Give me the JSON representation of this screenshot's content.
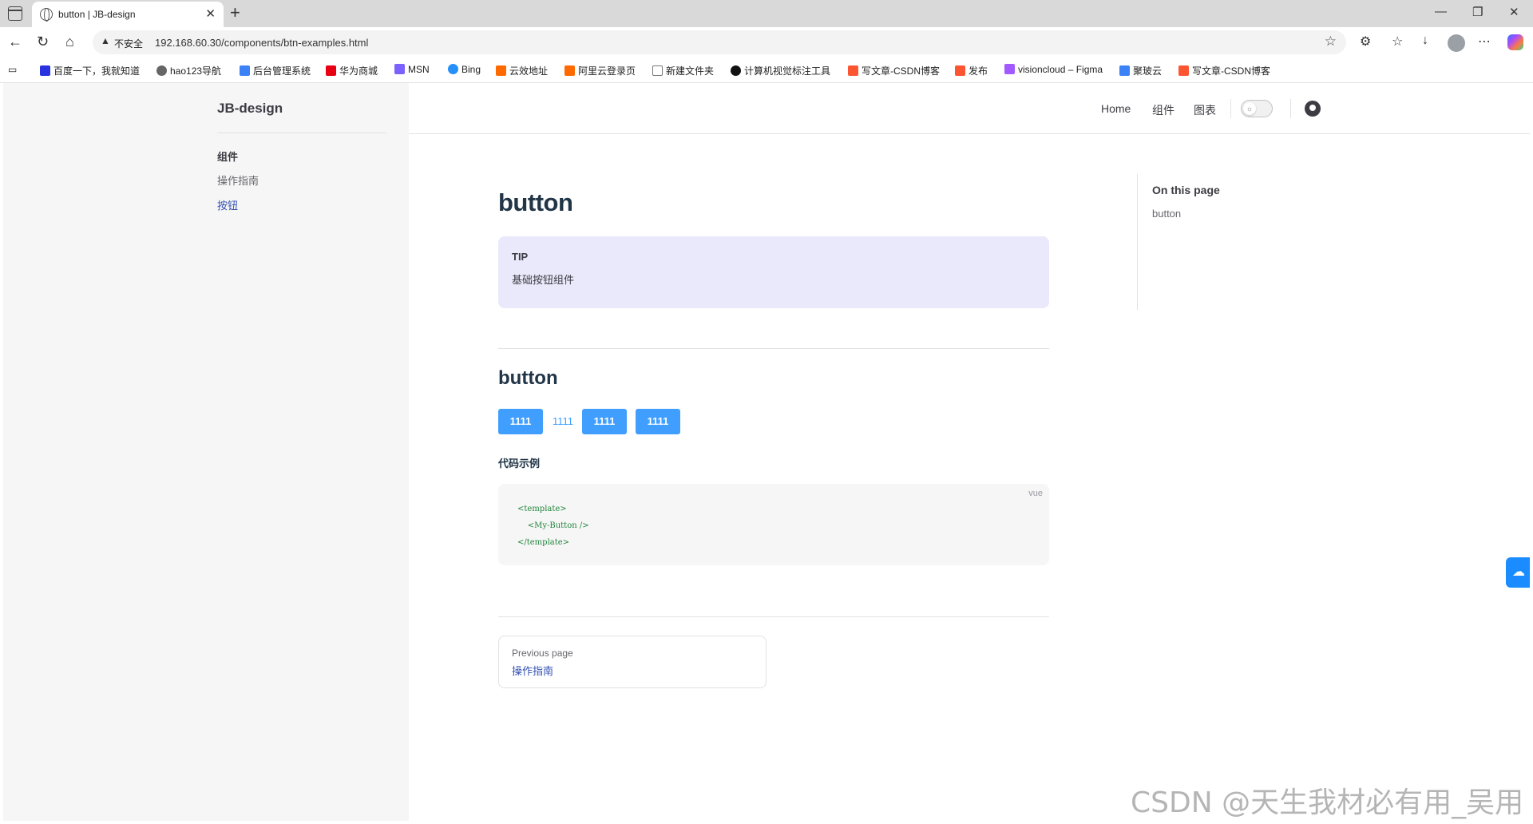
{
  "browser": {
    "tab_title": "button | JB-design",
    "tab_close": "✕",
    "new_tab": "+",
    "security_label": "不安全",
    "url": "192.168.60.30/components/btn-examples.html",
    "bookmarks": [
      {
        "label": "百度一下，我就知道",
        "color": "#2932e1"
      },
      {
        "label": "hao123导航",
        "color": "#666666"
      },
      {
        "label": "后台管理系统",
        "color": "#3b82f6"
      },
      {
        "label": "华为商城",
        "color": "#e60012"
      },
      {
        "label": "MSN",
        "color": "#7b61ff"
      },
      {
        "label": "Bing",
        "color": "#258ffa"
      },
      {
        "label": "云效地址",
        "color": "#ff6a00"
      },
      {
        "label": "阿里云登录页",
        "color": "#ff6a00"
      },
      {
        "label": "新建文件夹",
        "color": "#777777"
      },
      {
        "label": "计算机视觉标注工具",
        "color": "#111111"
      },
      {
        "label": "写文章-CSDN博客",
        "color": "#fc5531"
      },
      {
        "label": "发布",
        "color": "#fc5531"
      },
      {
        "label": "visioncloud – Figma",
        "color": "#a259ff"
      },
      {
        "label": "聚玻云",
        "color": "#3b82f6"
      },
      {
        "label": "写文章-CSDN博客",
        "color": "#fc5531"
      }
    ]
  },
  "site": {
    "title": "JB-design",
    "sidebar_group": "组件",
    "sidebar_items": [
      {
        "label": "操作指南",
        "active": false
      },
      {
        "label": "按钮",
        "active": true
      }
    ],
    "nav": [
      "Home",
      "组件",
      "图表"
    ]
  },
  "main": {
    "title": "button",
    "tip_label": "TIP",
    "tip_text": "基础按钮组件",
    "section_title": "button",
    "buttons": [
      "1111",
      "1111",
      "1111",
      "1111"
    ],
    "code_caption": "代码示例",
    "code_lang": "vue",
    "code_lines": [
      "<template>",
      "    <My-Button />",
      "</template>"
    ],
    "prev_desc": "Previous page",
    "prev_title": "操作指南"
  },
  "outline": {
    "title": "On this page",
    "items": [
      "button"
    ]
  },
  "watermark": "CSDN @天生我材必有用_吴用",
  "colors": {
    "primary_button": "#409eff",
    "link": "#3451b2",
    "tip_bg": "#e9e9fb"
  }
}
